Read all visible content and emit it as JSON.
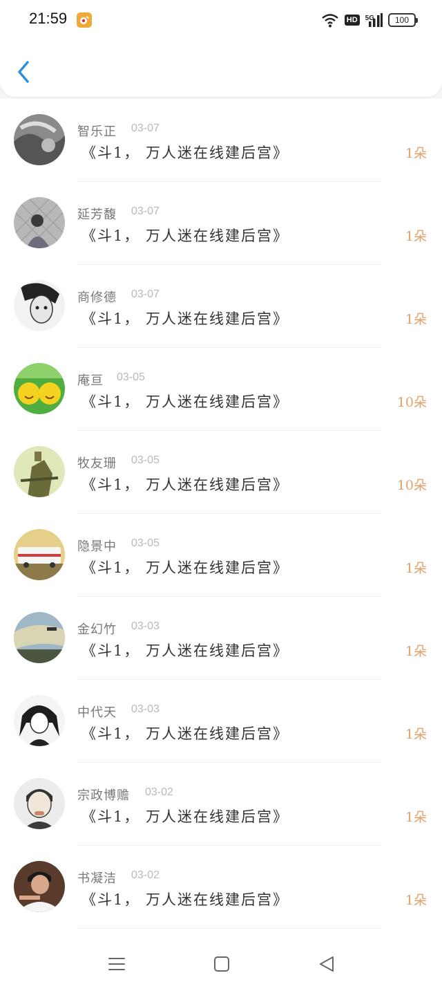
{
  "status_bar": {
    "time": "21:59",
    "hd": "HD",
    "network": "5G",
    "battery": "100"
  },
  "colors": {
    "amount": "#e2a06a",
    "back_arrow": "#2b8fe0"
  },
  "items": [
    {
      "name": "智乐正",
      "date": "03-07",
      "message": "《斗1， 万人迷在线建后宫》",
      "amount": "1朵"
    },
    {
      "name": "延芳馥",
      "date": "03-07",
      "message": "《斗1， 万人迷在线建后宫》",
      "amount": "1朵"
    },
    {
      "name": "商修德",
      "date": "03-07",
      "message": "《斗1， 万人迷在线建后宫》",
      "amount": "1朵"
    },
    {
      "name": "庵亘",
      "date": "03-05",
      "message": "《斗1， 万人迷在线建后宫》",
      "amount": "10朵"
    },
    {
      "name": "牧友珊",
      "date": "03-05",
      "message": "《斗1， 万人迷在线建后宫》",
      "amount": "10朵"
    },
    {
      "name": "隐景中",
      "date": "03-05",
      "message": "《斗1， 万人迷在线建后宫》",
      "amount": "1朵"
    },
    {
      "name": "金幻竹",
      "date": "03-03",
      "message": "《斗1， 万人迷在线建后宫》",
      "amount": "1朵"
    },
    {
      "name": "中代天",
      "date": "03-03",
      "message": "《斗1， 万人迷在线建后宫》",
      "amount": "1朵"
    },
    {
      "name": "宗政博赡",
      "date": "03-02",
      "message": "《斗1， 万人迷在线建后宫》",
      "amount": "1朵"
    },
    {
      "name": "书凝洁",
      "date": "03-02",
      "message": "《斗1， 万人迷在线建后宫》",
      "amount": "1朵"
    }
  ],
  "icons": {
    "back": "chevron-left-icon",
    "menu": "menu-icon",
    "home": "home-square-icon",
    "nav_back": "triangle-back-icon"
  }
}
